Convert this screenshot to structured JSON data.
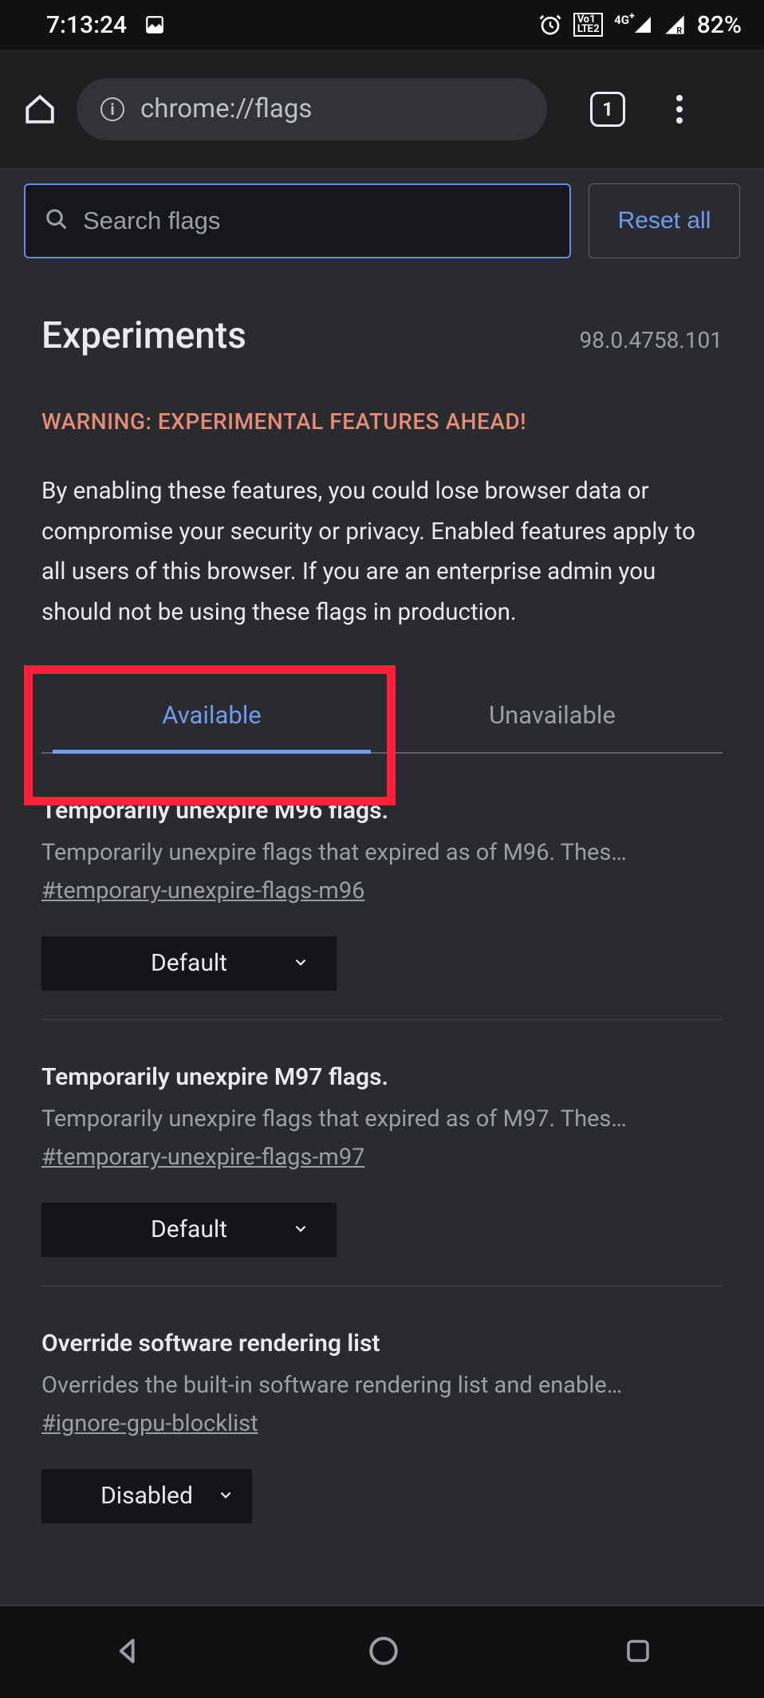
{
  "status": {
    "time": "7:13:24",
    "battery": "82%"
  },
  "chrome": {
    "url": "chrome://flags",
    "tab_count": "1"
  },
  "search": {
    "placeholder": "Search flags",
    "reset_label": "Reset all"
  },
  "header": {
    "title": "Experiments",
    "version": "98.0.4758.101",
    "warning": "WARNING: EXPERIMENTAL FEATURES AHEAD!",
    "description": "By enabling these features, you could lose browser data or compromise your security or privacy. Enabled features apply to all users of this browser. If you are an enterprise admin you should not be using these flags in production."
  },
  "tabs": {
    "available": "Available",
    "unavailable": "Unavailable"
  },
  "flags": [
    {
      "title": "Temporarily unexpire M96 flags.",
      "desc": "Temporarily unexpire flags that expired as of M96. Thes…",
      "anchor": "#temporary-unexpire-flags-m96",
      "value": "Default"
    },
    {
      "title": "Temporarily unexpire M97 flags.",
      "desc": "Temporarily unexpire flags that expired as of M97. Thes…",
      "anchor": "#temporary-unexpire-flags-m97",
      "value": "Default"
    },
    {
      "title": "Override software rendering list",
      "desc": "Overrides the built-in software rendering list and enable…",
      "anchor": "#ignore-gpu-blocklist",
      "value": "Disabled"
    }
  ]
}
